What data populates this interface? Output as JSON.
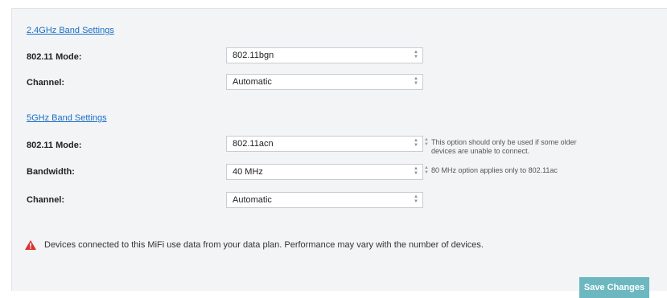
{
  "band_24": {
    "link": "2.4GHz Band Settings",
    "mode_label": "802.11 Mode:",
    "mode_value": "802.11bgn",
    "channel_label": "Channel:",
    "channel_value": "Automatic"
  },
  "band_5": {
    "link": "5GHz Band Settings",
    "mode_label": "802.11 Mode:",
    "mode_value": "802.11acn",
    "mode_help_line1": "This option should only be used if some older",
    "mode_help_line2": "devices are unable to connect.",
    "bandwidth_label": "Bandwidth:",
    "bandwidth_value": "40 MHz",
    "bandwidth_help": "80 MHz option applies only to 802.11ac",
    "channel_label": "Channel:",
    "channel_value": "Automatic"
  },
  "warning": {
    "icon": "warning-triangle-icon",
    "text": "Devices connected to this MiFi use data from your data plan. Performance may vary with the number of devices.",
    "color": "#d9312b"
  },
  "actions": {
    "save_label": "Save Changes",
    "save_color": "#6db8c0"
  }
}
